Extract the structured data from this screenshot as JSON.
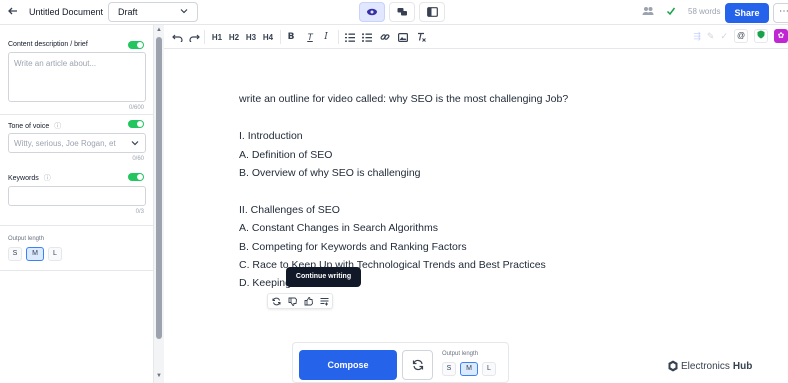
{
  "header": {
    "doc_title": "Untitled Document",
    "status": "Draft",
    "word_count": "58 words",
    "share_label": "Share",
    "more_label": "⋯"
  },
  "sidebar": {
    "content_label": "Content description / brief",
    "content_placeholder": "Write an article about...",
    "content_counter": "0/600",
    "tone_label": "Tone of voice",
    "tone_placeholder": "Witty, serious, Joe Rogan, et",
    "tone_counter": "0/60",
    "keywords_label": "Keywords",
    "keywords_counter": "0/3",
    "output_length_label": "Output length",
    "sizes": [
      "S",
      "M",
      "L"
    ],
    "selected_size": "M"
  },
  "toolbar": {
    "headings": [
      "H1",
      "H2",
      "H3",
      "H4"
    ]
  },
  "editor": {
    "lines": [
      "write an outline for video called: why SEO is the most challenging Job?",
      "I. Introduction",
      "A. Definition of SEO",
      "B. Overview of why SEO is challenging",
      "II. Challenges of SEO",
      "A. Constant Changes in Search Algorithms",
      "B. Competing for Keywords and Ranking Factors",
      "C. Race to Keep Up with Technological Trends and Best Practices",
      "D. Keeping"
    ],
    "tooltip": "Continue writing"
  },
  "compose": {
    "compose_label": "Compose",
    "output_length_label": "Output length",
    "sizes": [
      "S",
      "M",
      "L"
    ]
  },
  "watermark": {
    "brand_a": "Electronics",
    "brand_b": "Hub"
  },
  "colors": {
    "accent": "#2563eb",
    "toggle_on": "#22c55e"
  }
}
